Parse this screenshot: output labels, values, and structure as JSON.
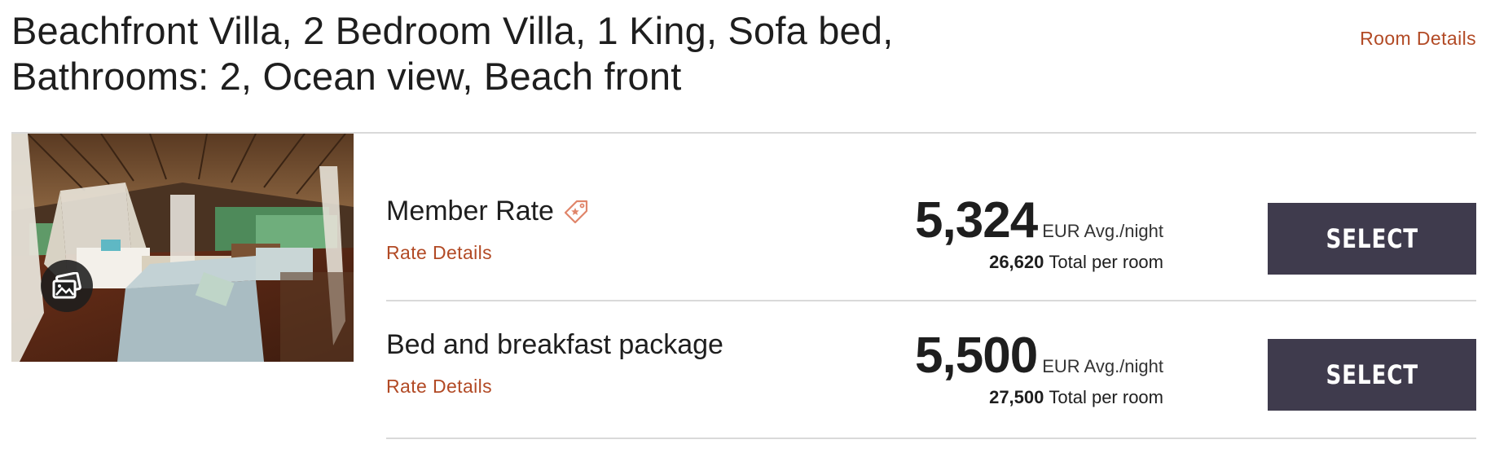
{
  "room": {
    "title": "Beachfront Villa, 2 Bedroom Villa, 1 King, Sofa bed, Bathrooms: 2, Ocean view, Beach front",
    "details_link": "Room Details",
    "photo_icon": "gallery-icon"
  },
  "rates": [
    {
      "name": "Member Rate",
      "badge_icon": "member-tag-icon",
      "details_link": "Rate Details",
      "price": "5,324",
      "price_unit": "EUR Avg./night",
      "total": "26,620",
      "total_label": "Total per room",
      "button": "SELECT"
    },
    {
      "name": "Bed and breakfast package",
      "details_link": "Rate Details",
      "price": "5,500",
      "price_unit": "EUR Avg./night",
      "total": "27,500",
      "total_label": "Total per room",
      "button": "SELECT"
    }
  ],
  "colors": {
    "link": "#b24a25",
    "button_bg": "#3f3b4d",
    "button_text": "#ffffff",
    "divider": "#d9d9d9",
    "text": "#1e1e1e"
  }
}
